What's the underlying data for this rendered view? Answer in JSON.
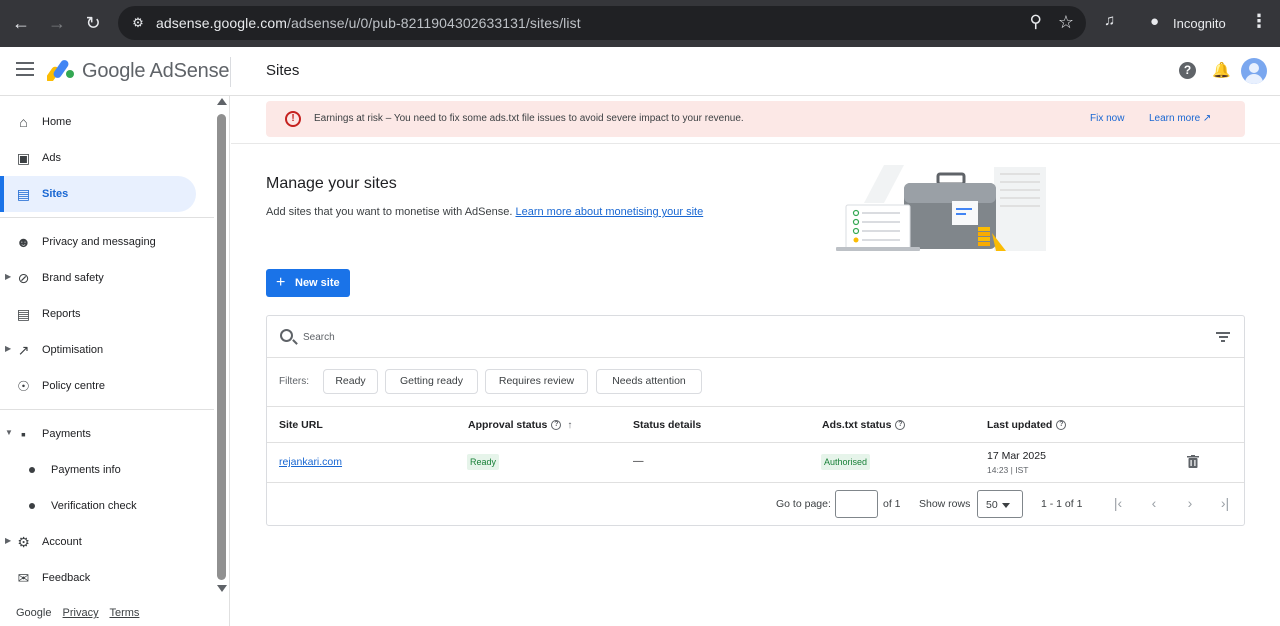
{
  "browser": {
    "url_host": "adsense.google.com",
    "url_path": "/adsense/u/0/pub-8211904302633131/sites/list",
    "incognito_label": "Incognito"
  },
  "header": {
    "brand": "Google AdSense",
    "page_title": "Sites"
  },
  "sidebar": {
    "items": [
      {
        "label": "Home",
        "icon": "home-icon"
      },
      {
        "label": "Ads",
        "icon": "ads-icon"
      },
      {
        "label": "Sites",
        "icon": "sites-icon"
      },
      {
        "label": "Privacy and messaging",
        "icon": "privacy-icon"
      },
      {
        "label": "Brand safety",
        "icon": "block-icon"
      },
      {
        "label": "Reports",
        "icon": "reports-icon"
      },
      {
        "label": "Optimisation",
        "icon": "trending-icon"
      },
      {
        "label": "Policy centre",
        "icon": "policy-icon"
      },
      {
        "label": "Payments",
        "icon": "payments-icon"
      },
      {
        "label": "Payments info",
        "icon": "bullet-icon"
      },
      {
        "label": "Verification check",
        "icon": "bullet-icon"
      },
      {
        "label": "Account",
        "icon": "gear-icon"
      },
      {
        "label": "Feedback",
        "icon": "feedback-icon"
      }
    ],
    "footer": {
      "google": "Google",
      "privacy": "Privacy",
      "terms": "Terms"
    }
  },
  "banner": {
    "message": "Earnings at risk – You need to fix some ads.txt file issues to avoid severe impact to your revenue.",
    "fix_now": "Fix now",
    "learn_more": "Learn more"
  },
  "main": {
    "heading": "Manage your sites",
    "subtitle": "Add sites that you want to monetise with AdSense.",
    "subtitle_link": "Learn more about monetising your site",
    "new_site": "New site"
  },
  "table": {
    "search_placeholder": "Search",
    "filters_label": "Filters:",
    "filters": [
      "Ready",
      "Getting ready",
      "Requires review",
      "Needs attention"
    ],
    "columns": [
      "Site URL",
      "Approval status",
      "Status details",
      "Ads.txt status",
      "Last updated"
    ],
    "rows": [
      {
        "site_url": "rejankari.com",
        "approval_status": "Ready",
        "status_details": "—",
        "ads_txt_status": "Authorised",
        "last_updated_date": "17 Mar 2025",
        "last_updated_time": "14:23 | IST"
      }
    ],
    "pager": {
      "go_to_page": "Go to page:",
      "of_pages": "of 1",
      "show_rows": "Show rows",
      "rows_value": "50",
      "range": "1 - 1 of 1"
    }
  },
  "colors": {
    "primary": "#1a73e8",
    "banner_bg": "#fce8e6",
    "error": "#c5221f",
    "success": "#188038"
  }
}
